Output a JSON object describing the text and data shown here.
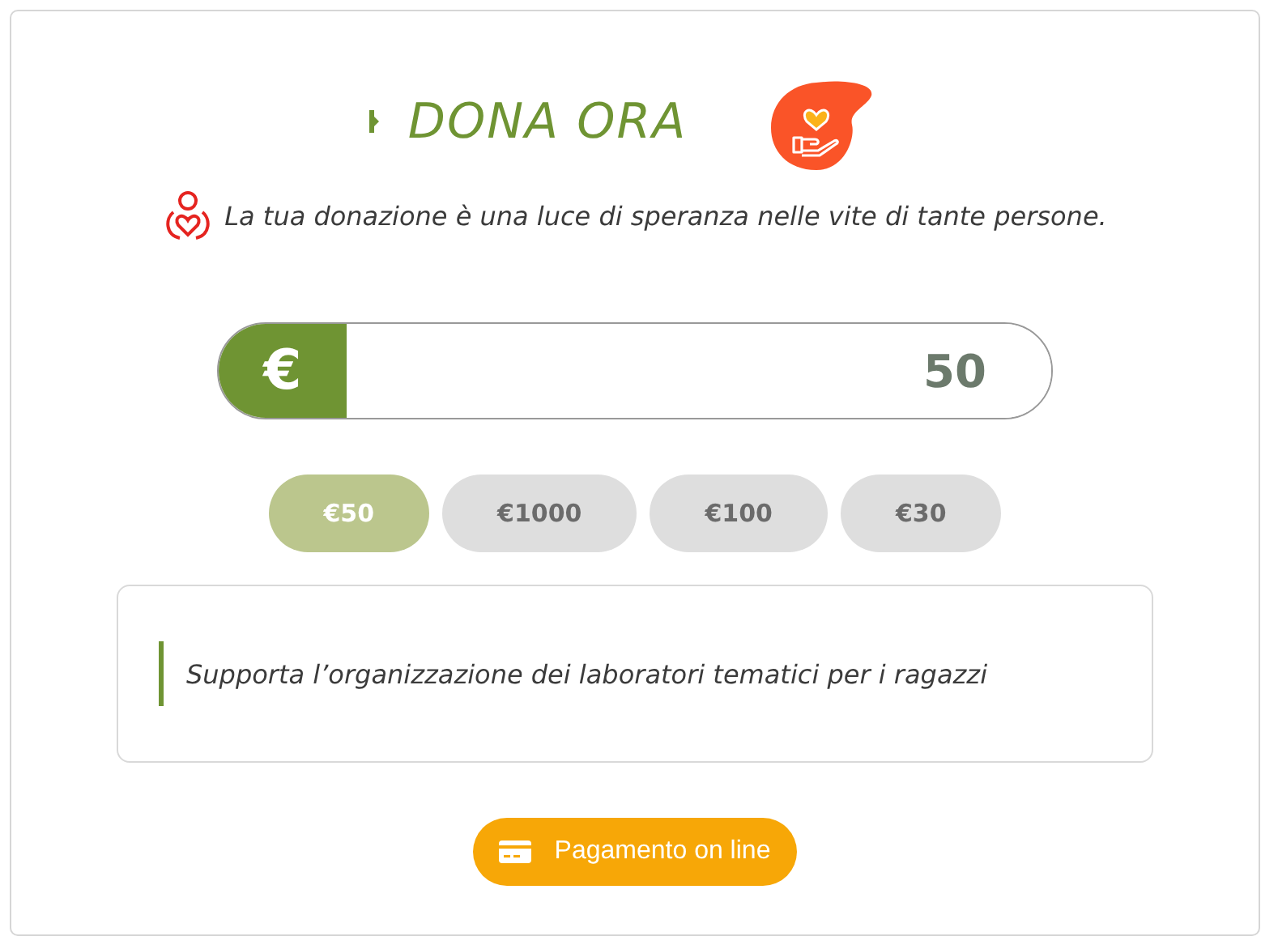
{
  "title": "DONA ORA",
  "subtitle": "La tua donazione è una luce di speranza nelle vite di tante persone.",
  "amount": {
    "currency": "€",
    "value": "50"
  },
  "presets": [
    {
      "label": "€50",
      "selected": true
    },
    {
      "label": "€1000",
      "selected": false
    },
    {
      "label": "€100",
      "selected": false
    },
    {
      "label": "€30",
      "selected": false
    }
  ],
  "description": "Supporta l’organizzazione dei laboratori tematici per i ragazzi",
  "pay_button": {
    "label": "Pagamento on line"
  }
}
